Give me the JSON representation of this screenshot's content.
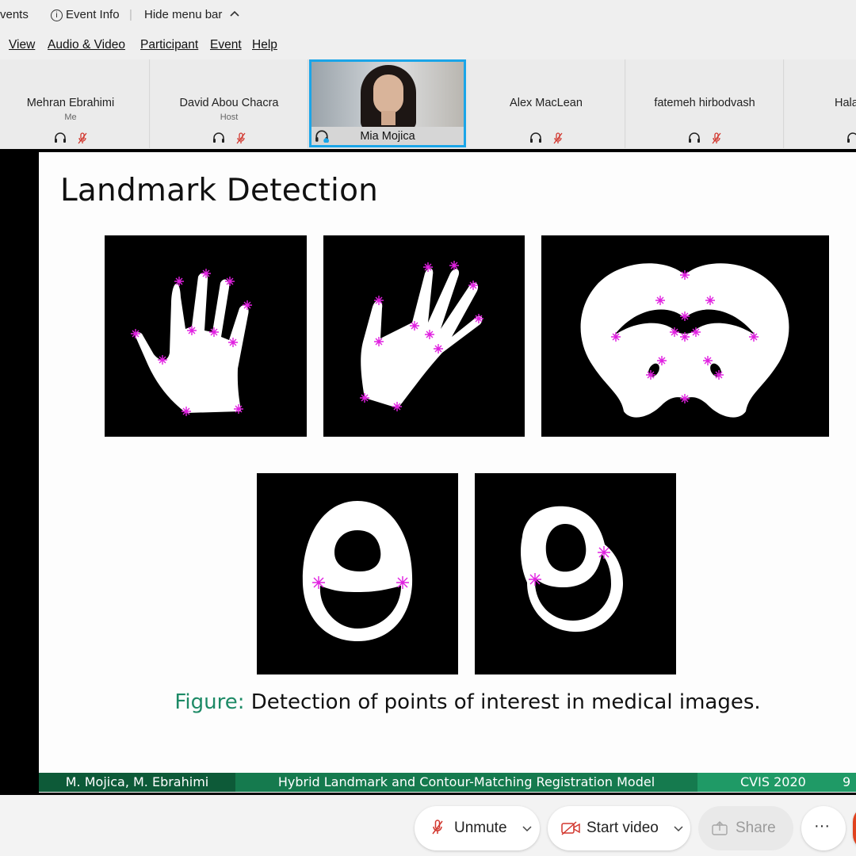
{
  "topbar": {
    "events_label": "vents",
    "event_info_label": "Event Info",
    "hide_menu_label": "Hide menu bar"
  },
  "menubar": {
    "items": [
      "View",
      "Audio & Video",
      "Participant",
      "Event",
      "Help"
    ]
  },
  "participants": [
    {
      "name": "Mehran Ebrahimi",
      "role": "Me"
    },
    {
      "name": "David Abou Chacra",
      "role": "Host"
    },
    {
      "name": "Mia Mojica",
      "role": ""
    },
    {
      "name": "Alex MacLean",
      "role": ""
    },
    {
      "name": "fatemeh hirbodvash",
      "role": ""
    },
    {
      "name": "Hala",
      "role": ""
    }
  ],
  "slide": {
    "title": "Landmark Detection",
    "caption_label": "Figure:",
    "caption_text": "Detection of points of interest in medical images.",
    "footer": {
      "authors": "M. Mojica, M. Ebrahimi",
      "talk_title": "Hybrid Landmark and Contour-Matching Registration Model",
      "venue": "CVIS 2020",
      "page": "9"
    }
  },
  "toolbar": {
    "unmute_label": "Unmute",
    "start_video_label": "Start video",
    "share_label": "Share",
    "more_label": "···"
  },
  "colors": {
    "active_speaker_border": "#1aa5e8",
    "landmark_marker": "#e020e0",
    "muted_icon": "#d2372e",
    "footer_dark": "#0d5a38",
    "footer_mid": "#157a4e",
    "footer_light": "#1f9a66",
    "caption_label": "#1d8a66"
  }
}
